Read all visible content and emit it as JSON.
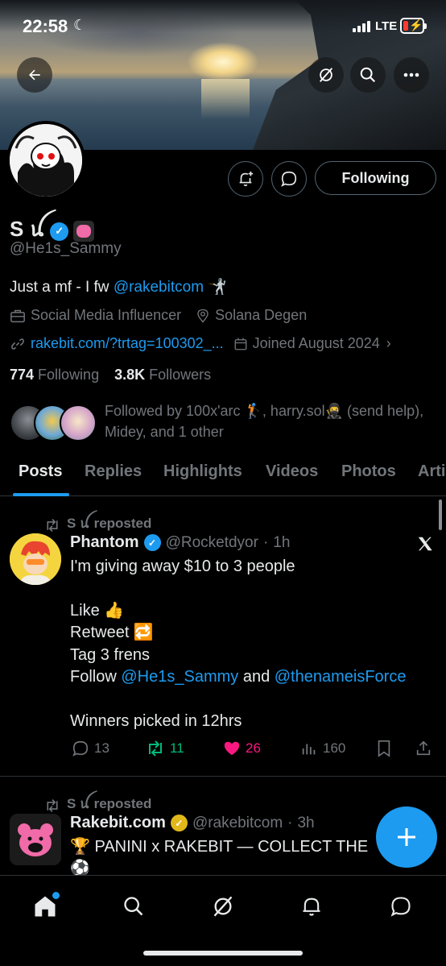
{
  "status_bar": {
    "time": "22:58",
    "network": "LTE",
    "battery_color": "#ff3b30"
  },
  "profile": {
    "display_name": "S ꪊ",
    "handle": "@He1s_Sammy",
    "bio_prefix": "Just a mf - I fw ",
    "bio_mention": "@rakebitcom",
    "bio_emoji": "🤺",
    "category": "Social Media Influencer",
    "location": "Solana Degen",
    "website": "rakebit.com/?trtag=100302_...",
    "joined": "Joined August 2024",
    "following_count": "774",
    "following_label": " Following",
    "followers_count": "3.8K",
    "followers_label": " Followers",
    "followed_by": "Followed by 100x'arc 🏌️, harry.sol🥷 (send help), Midey, and 1 other",
    "follow_button": "Following"
  },
  "tabs": [
    "Posts",
    "Replies",
    "Highlights",
    "Videos",
    "Photos",
    "Arti"
  ],
  "posts": [
    {
      "repost_label": "S ꪊ reposted",
      "author_name": "Phantom",
      "author_handle": "@Rocketdyor",
      "time": "1h",
      "lines": [
        "I'm giving away $10 to 3 people",
        "",
        "Like 👍",
        "Retweet 🔁",
        "Tag 3 frens"
      ],
      "follow_prefix": "Follow ",
      "mention1": "@He1s_Sammy",
      "follow_and": " and ",
      "mention2": "@thenameisForce",
      "closing": "Winners picked in 12hrs",
      "replies": "13",
      "reposts": "11",
      "likes": "26",
      "views": "160"
    },
    {
      "repost_label": "S ꪊ reposted",
      "author_name": "Rakebit.com",
      "author_handle": "@rakebitcom",
      "time": "3h",
      "line1": "🏆 PANINI x RAKEBIT — COLLECT THE",
      "line2": "⚽"
    }
  ],
  "icons": {
    "back": "arrow-left-icon",
    "grok": "grok-icon",
    "search": "search-icon",
    "more": "more-icon",
    "notify": "bell-plus-icon",
    "message": "message-icon",
    "x_logo": "x-logo-icon"
  },
  "colors": {
    "accent": "#1d9bf0",
    "like": "#f91880",
    "repost": "#00ba7c",
    "gold_badge": "#e2b719"
  }
}
